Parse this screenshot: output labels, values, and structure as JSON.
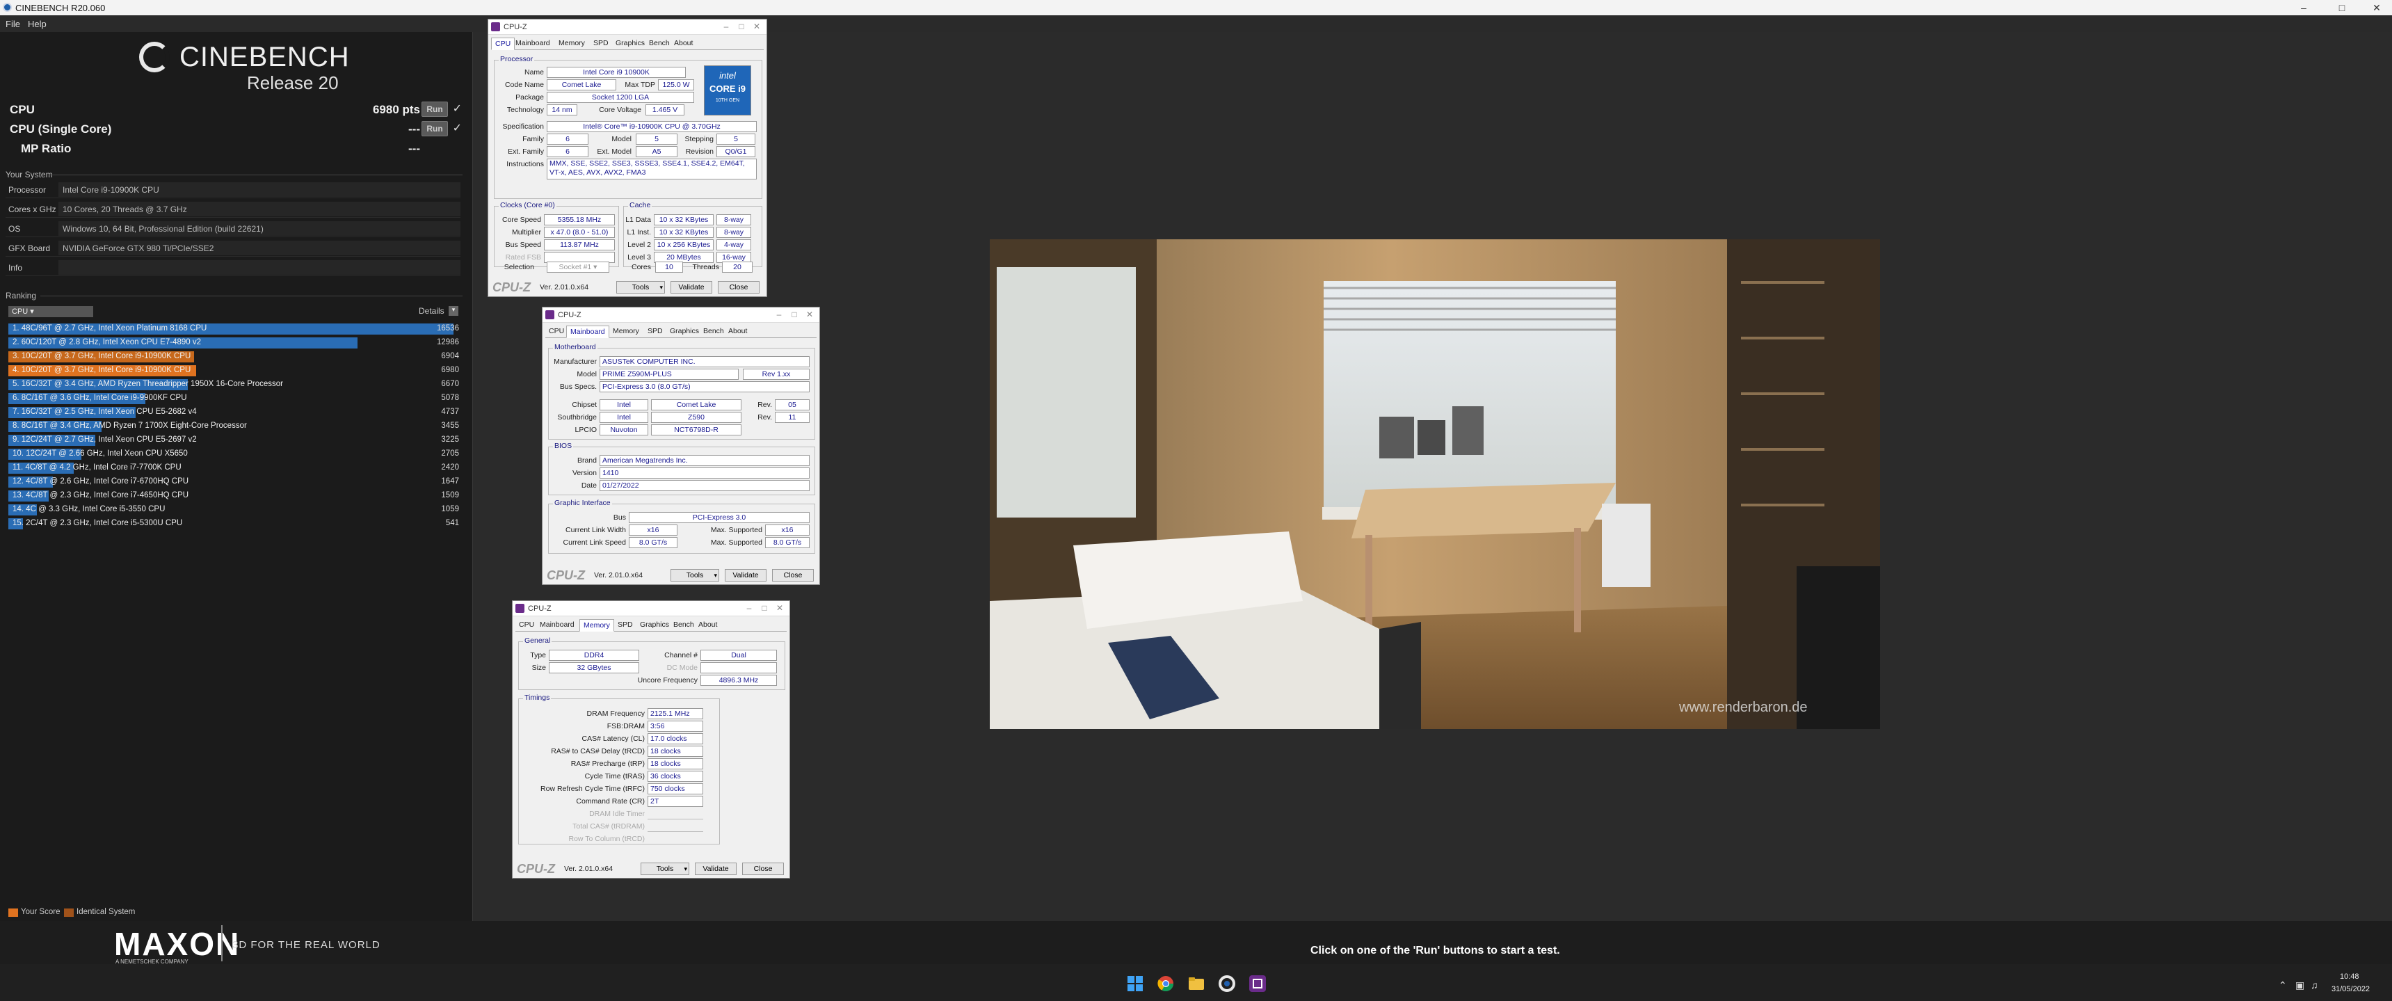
{
  "window": {
    "title": "CINEBENCH R20.060"
  },
  "menu": {
    "file": "File",
    "help": "Help"
  },
  "logo": {
    "name": "CINEBENCH",
    "release": "Release 20"
  },
  "bench": {
    "cpu_label": "CPU",
    "cpu_value": "6980 pts",
    "single_label": "CPU (Single Core)",
    "single_value": "---",
    "mp_label": "MP Ratio",
    "mp_value": "---",
    "run": "Run",
    "check": "✓"
  },
  "system": {
    "title": "Your System",
    "rows": [
      {
        "k": "Processor",
        "v": "Intel Core i9-10900K CPU"
      },
      {
        "k": "Cores x GHz",
        "v": "10 Cores, 20 Threads @ 3.7 GHz"
      },
      {
        "k": "OS",
        "v": "Windows 10, 64 Bit, Professional Edition (build 22621)"
      },
      {
        "k": "GFX Board",
        "v": "NVIDIA GeForce GTX 980 Ti/PCIe/SSE2"
      },
      {
        "k": "Info",
        "v": ""
      }
    ]
  },
  "ranking": {
    "title": "Ranking",
    "select": "CPU",
    "details": "Details",
    "rows": [
      {
        "label": "1. 48C/96T @ 2.7 GHz, Intel Xeon Platinum 8168 CPU",
        "score": "16536",
        "frac": 1.0,
        "color": "#2a6db5"
      },
      {
        "label": "2. 60C/120T @ 2.8 GHz, Intel Xeon CPU E7-4890 v2",
        "score": "12986",
        "frac": 0.785,
        "color": "#2a6db5"
      },
      {
        "label": "3. 10C/20T @ 3.7 GHz, Intel Core i9-10900K CPU",
        "score": "6904",
        "frac": 0.4175,
        "color": "#c7681b"
      },
      {
        "label": "4. 10C/20T @ 3.7 GHz, Intel Core i9-10900K CPU",
        "score": "6980",
        "frac": 0.4221,
        "color": "#e07320"
      },
      {
        "label": "5. 16C/32T @ 3.4 GHz, AMD Ryzen Threadripper 1950X 16-Core Processor",
        "score": "6670",
        "frac": 0.4034,
        "color": "#2a6db5"
      },
      {
        "label": "6. 8C/16T @ 3.6 GHz, Intel Core i9-9900KF CPU",
        "score": "5078",
        "frac": 0.3071,
        "color": "#2a6db5"
      },
      {
        "label": "7. 16C/32T @ 2.5 GHz, Intel Xeon CPU E5-2682 v4",
        "score": "4737",
        "frac": 0.2865,
        "color": "#2a6db5"
      },
      {
        "label": "8. 8C/16T @ 3.4 GHz, AMD Ryzen 7 1700X Eight-Core Processor",
        "score": "3455",
        "frac": 0.2089,
        "color": "#2a6db5"
      },
      {
        "label": "9. 12C/24T @ 2.7 GHz, Intel Xeon CPU E5-2697 v2",
        "score": "3225",
        "frac": 0.195,
        "color": "#2a6db5"
      },
      {
        "label": "10. 12C/24T @ 2.66 GHz, Intel Xeon CPU X5650",
        "score": "2705",
        "frac": 0.1636,
        "color": "#2a6db5"
      },
      {
        "label": "11. 4C/8T @ 4.2 GHz, Intel Core i7-7700K CPU",
        "score": "2420",
        "frac": 0.1463,
        "color": "#2a6db5"
      },
      {
        "label": "12. 4C/8T @ 2.6 GHz, Intel Core i7-6700HQ CPU",
        "score": "1647",
        "frac": 0.0996,
        "color": "#2a6db5"
      },
      {
        "label": "13. 4C/8T @ 2.3 GHz, Intel Core i7-4650HQ CPU",
        "score": "1509",
        "frac": 0.0913,
        "color": "#2a6db5"
      },
      {
        "label": "14. 4C @ 3.3 GHz, Intel Core i5-3550 CPU",
        "score": "1059",
        "frac": 0.064,
        "color": "#2a6db5"
      },
      {
        "label": "15. 2C/4T @ 2.3 GHz, Intel Core i5-5300U CPU",
        "score": "541",
        "frac": 0.0327,
        "color": "#2a6db5"
      }
    ],
    "legend_your": "Your Score",
    "legend_identical": "Identical System",
    "color_your": "#e07320",
    "color_identical": "#a0521a"
  },
  "footer": {
    "brand": "MAXON",
    "brand_sub": "A NEMETSCHEK COMPANY",
    "tagline": "3D FOR THE REAL WORLD",
    "status": "Click on one of the 'Run' buttons to start a test."
  },
  "render": {
    "watermark": "www.renderbaron.de"
  },
  "taskbar": {
    "time": "10:48",
    "date": "31/05/2022"
  },
  "cpuz_common": {
    "title": "CPU-Z",
    "tabs": [
      "CPU",
      "Mainboard",
      "Memory",
      "SPD",
      "Graphics",
      "Bench",
      "About"
    ],
    "logo": "CPU-Z",
    "ver": "Ver. 2.01.0.x64",
    "tools": "Tools",
    "validate": "Validate",
    "close": "Close"
  },
  "cpuz_cpu": {
    "processor_group": "Processor",
    "name_l": "Name",
    "name": "Intel Core i9 10900K",
    "code_l": "Code Name",
    "code": "Comet Lake",
    "tdp_l": "Max TDP",
    "tdp": "125.0 W",
    "pkg_l": "Package",
    "pkg": "Socket 1200 LGA",
    "tech_l": "Technology",
    "tech": "14 nm",
    "volt_l": "Core Voltage",
    "volt": "1.465 V",
    "spec_l": "Specification",
    "spec": "Intel® Core™ i9-10900K CPU @ 3.70GHz",
    "fam_l": "Family",
    "fam": "6",
    "model_l": "Model",
    "model": "5",
    "step_l": "Stepping",
    "step": "5",
    "efam_l": "Ext. Family",
    "efam": "6",
    "emodel_l": "Ext. Model",
    "emodel": "A5",
    "rev_l": "Revision",
    "rev": "Q0/G1",
    "inst_l": "Instructions",
    "inst": "MMX, SSE, SSE2, SSE3, SSSE3, SSE4.1, SSE4.2, EM64T, VT-x, AES, AVX, AVX2, FMA3",
    "clocks_group": "Clocks (Core #0)",
    "cache_group": "Cache",
    "cs_l": "Core Speed",
    "cs": "5355.18 MHz",
    "mult_l": "Multiplier",
    "mult": "x 47.0 (8.0 - 51.0)",
    "bus_l": "Bus Speed",
    "bus": "113.87 MHz",
    "fsb_l": "Rated FSB",
    "fsb": "",
    "l1d_l": "L1 Data",
    "l1d": "10 x 32 KBytes",
    "l1d_w": "8-way",
    "l1i_l": "L1 Inst.",
    "l1i": "10 x 32 KBytes",
    "l1i_w": "8-way",
    "l2_l": "Level 2",
    "l2": "10 x 256 KBytes",
    "l2_w": "4-way",
    "l3_l": "Level 3",
    "l3": "20 MBytes",
    "l3_w": "16-way",
    "sel_l": "Selection",
    "sel": "Socket #1",
    "cores_l": "Cores",
    "cores": "10",
    "threads_l": "Threads",
    "threads": "20",
    "badge_top": "intel",
    "badge_mid": "CORE i9",
    "badge_bot": "10TH GEN"
  },
  "cpuz_mb": {
    "mb_group": "Motherboard",
    "man_l": "Manufacturer",
    "man": "ASUSTeK COMPUTER INC.",
    "model_l": "Model",
    "model": "PRIME Z590M-PLUS",
    "rev": "Rev 1.xx",
    "busspec_l": "Bus Specs.",
    "busspec": "PCI-Express 3.0 (8.0 GT/s)",
    "chip_l": "Chipset",
    "chip_a": "Intel",
    "chip_b": "Comet Lake",
    "chip_rev_l": "Rev.",
    "chip_rev": "05",
    "sb_l": "Southbridge",
    "sb_a": "Intel",
    "sb_b": "Z590",
    "sb_rev_l": "Rev.",
    "sb_rev": "11",
    "lpc_l": "LPCIO",
    "lpc_a": "Nuvoton",
    "lpc_b": "NCT6798D-R",
    "bios_group": "BIOS",
    "brand_l": "Brand",
    "brand": "American Megatrends Inc.",
    "ver_l": "Version",
    "ver": "1410",
    "date_l": "Date",
    "date": "01/27/2022",
    "gi_group": "Graphic Interface",
    "gbus_l": "Bus",
    "gbus": "PCI-Express 3.0",
    "clw_l": "Current Link Width",
    "clw": "x16",
    "msw_l": "Max. Supported",
    "msw": "x16",
    "cls_l": "Current Link Speed",
    "cls": "8.0 GT/s",
    "mss_l": "Max. Supported",
    "mss": "8.0 GT/s"
  },
  "cpuz_mem": {
    "gen_group": "General",
    "type_l": "Type",
    "type": "DDR4",
    "chan_l": "Channel #",
    "chan": "Dual",
    "size_l": "Size",
    "size": "32 GBytes",
    "dc_l": "DC Mode",
    "dc": "",
    "unc_l": "Uncore Frequency",
    "unc": "4896.3 MHz",
    "tim_group": "Timings",
    "rows": [
      {
        "k": "DRAM Frequency",
        "v": "2125.1 MHz",
        "dis": false
      },
      {
        "k": "FSB:DRAM",
        "v": "3:56",
        "dis": false
      },
      {
        "k": "CAS# Latency (CL)",
        "v": "17.0 clocks",
        "dis": false
      },
      {
        "k": "RAS# to CAS# Delay (tRCD)",
        "v": "18 clocks",
        "dis": false
      },
      {
        "k": "RAS# Precharge (tRP)",
        "v": "18 clocks",
        "dis": false
      },
      {
        "k": "Cycle Time (tRAS)",
        "v": "36 clocks",
        "dis": false
      },
      {
        "k": "Row Refresh Cycle Time (tRFC)",
        "v": "750 clocks",
        "dis": false
      },
      {
        "k": "Command Rate (CR)",
        "v": "2T",
        "dis": false
      },
      {
        "k": "DRAM Idle Timer",
        "v": "",
        "dis": true
      },
      {
        "k": "Total CAS# (tRDRAM)",
        "v": "",
        "dis": true
      },
      {
        "k": "Row To Column (tRCD)",
        "v": "",
        "dis": true
      }
    ]
  }
}
